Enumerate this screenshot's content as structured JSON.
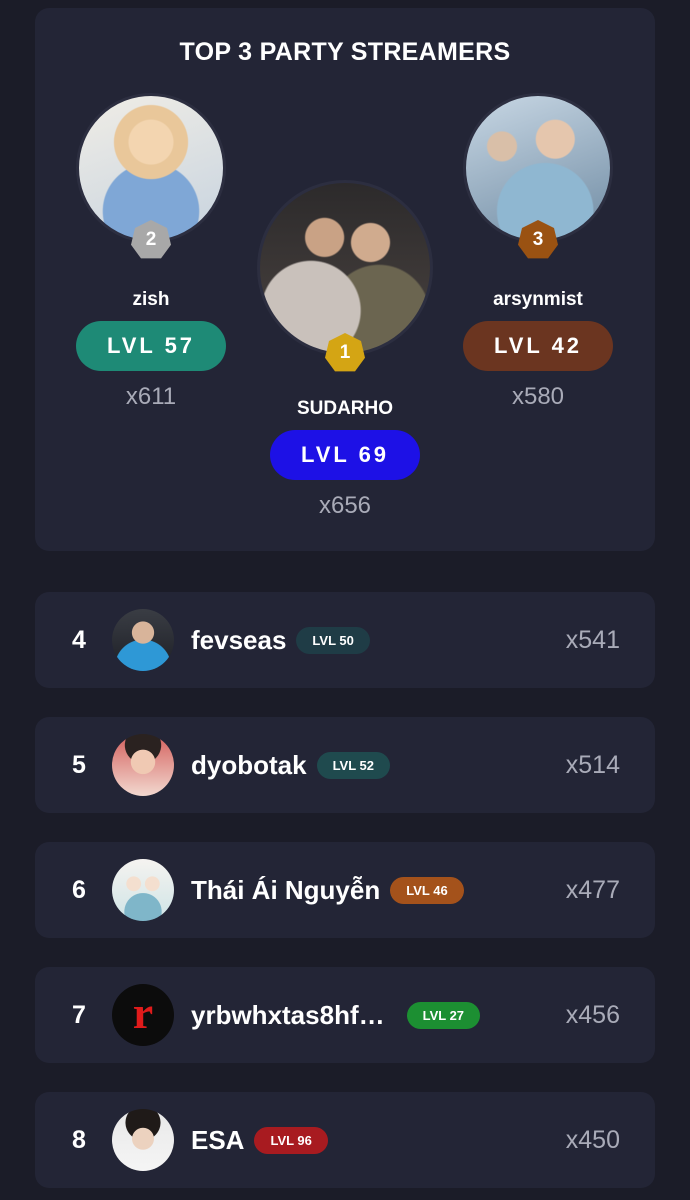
{
  "top_card": {
    "title": "TOP 3 PARTY STREAMERS",
    "podium": [
      {
        "rank": "2",
        "name": "zish",
        "level": "LVL 57",
        "count": "x611",
        "level_color": "#1e8a76",
        "badge_color": "#a8a8a8"
      },
      {
        "rank": "1",
        "name": "SUDARHO",
        "level": "LVL 69",
        "count": "x656",
        "level_color": "#1d11e6",
        "badge_color": "#d4a514"
      },
      {
        "rank": "3",
        "name": "arsynmist",
        "level": "LVL 42",
        "count": "x580",
        "level_color": "#6b3520",
        "badge_color": "#9a5212"
      }
    ]
  },
  "rows": [
    {
      "rank": "4",
      "name": "fevseas",
      "level": "LVL 50",
      "count": "x541",
      "level_color": "#1f3c46"
    },
    {
      "rank": "5",
      "name": "dyobotak",
      "level": "LVL 52",
      "count": "x514",
      "level_color": "#1f4a4e"
    },
    {
      "rank": "6",
      "name": "Thái Ái Nguyễn",
      "level": "LVL 46",
      "count": "x477",
      "level_color": "#a4521b"
    },
    {
      "rank": "7",
      "name": "yrbwhxtas8hf…",
      "level": "LVL 27",
      "count": "x456",
      "level_color": "#1c8f32"
    },
    {
      "rank": "8",
      "name": "ESA",
      "level": "LVL 96",
      "count": "x450",
      "level_color": "#a81b20"
    }
  ],
  "avatar_icons": {
    "rank_7": "r"
  }
}
